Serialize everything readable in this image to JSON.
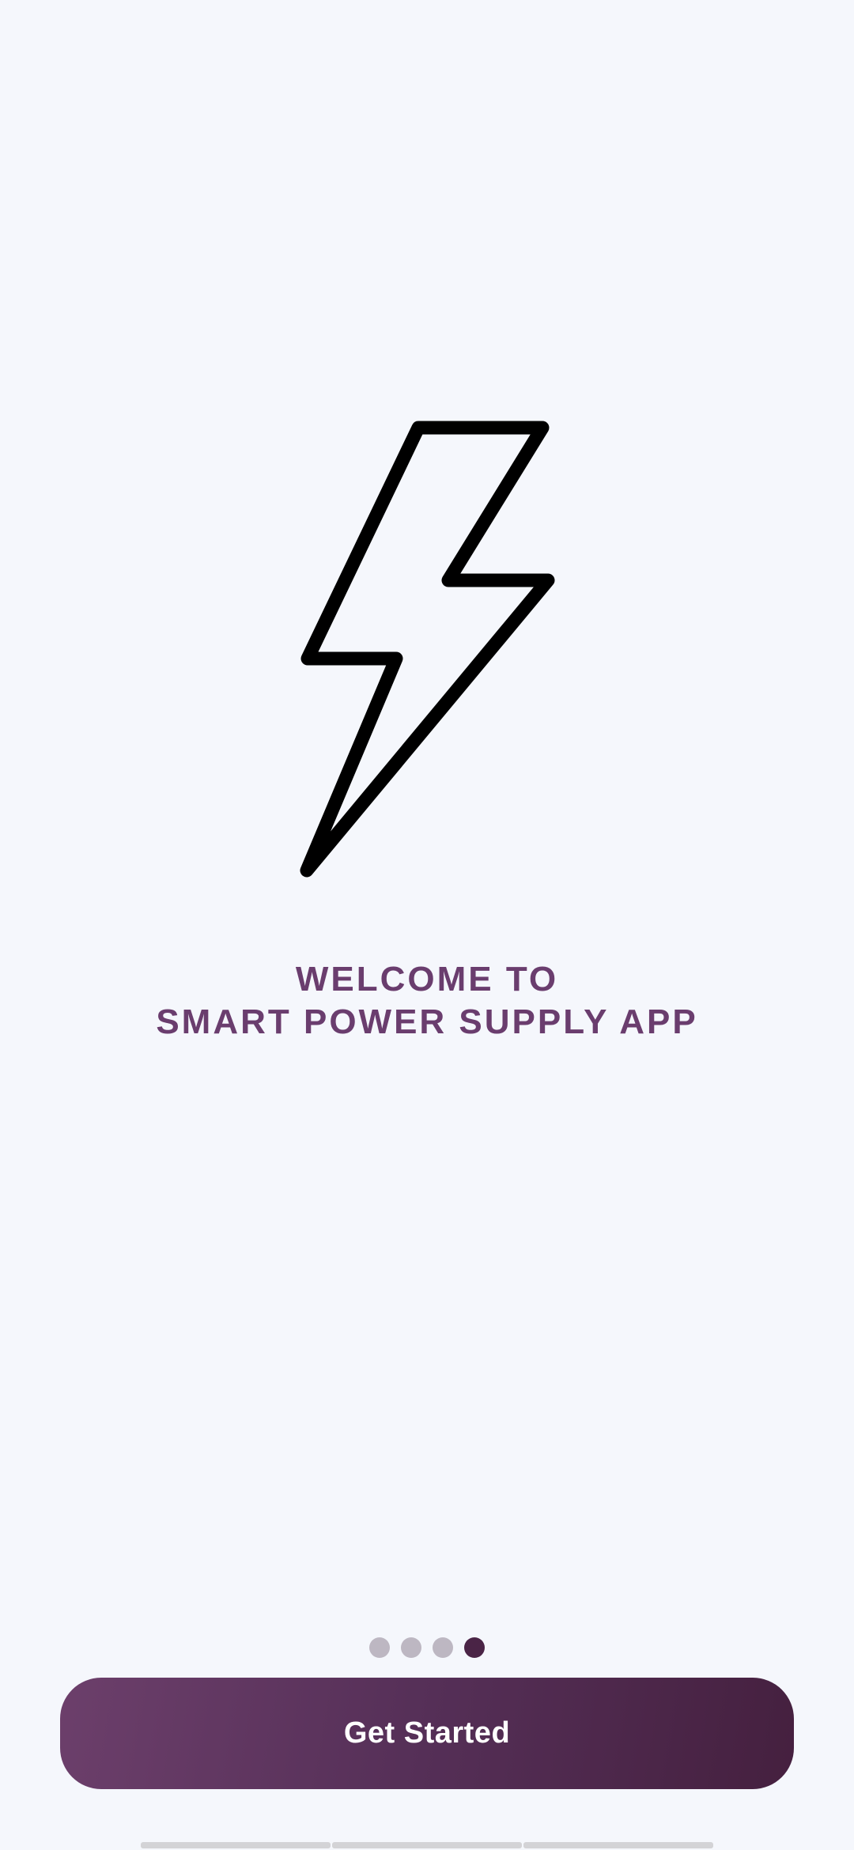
{
  "welcome": {
    "line1": "WELCOME TO",
    "line2": "SMART POWER SUPPLY APP"
  },
  "pager": {
    "total": 4,
    "active_index": 3
  },
  "cta": {
    "label": "Get Started"
  },
  "icons": {
    "hero": "lightning-bolt-icon"
  },
  "colors": {
    "background": "#f5f7fc",
    "title": "#6a3d6e",
    "button_gradient_start": "#6c3f6b",
    "button_gradient_end": "#45203f",
    "dot_inactive": "#bdb7c2",
    "dot_active": "#4a2446"
  }
}
